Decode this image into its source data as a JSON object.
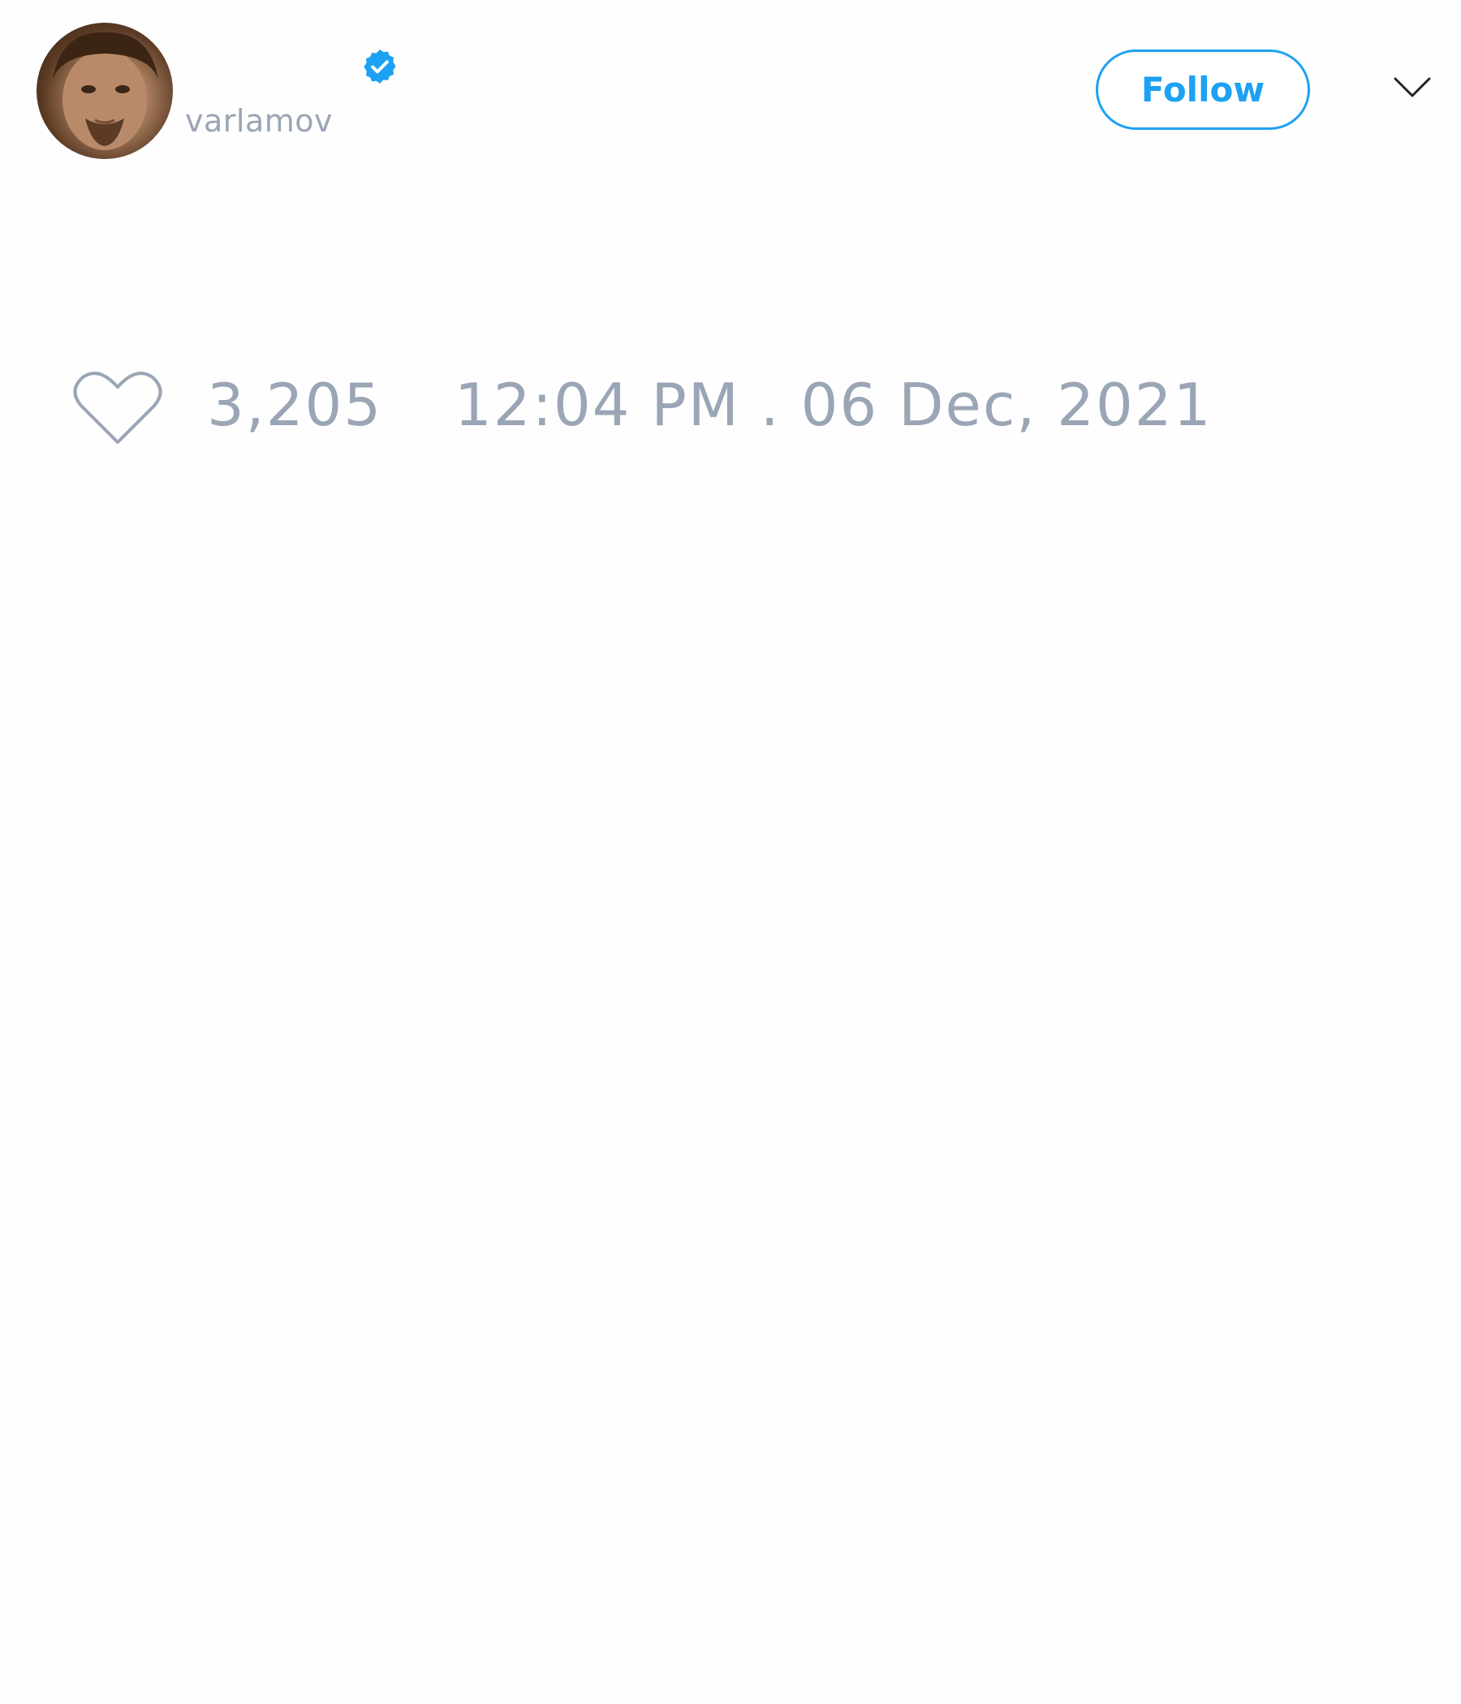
{
  "author": {
    "handle": "varlamov",
    "verified": true,
    "avatar_icon": "profile-photo"
  },
  "header": {
    "follow_label": "Follow",
    "menu_icon": "chevron-down-icon"
  },
  "tweet": {
    "like_icon": "heart-icon",
    "like_count": "3,205",
    "timestamp": "12:04 PM . 06 Dec, 2021"
  },
  "colors": {
    "accent": "#1da1f2",
    "muted_text": "#9aa5b5",
    "background": "#fefefe"
  }
}
